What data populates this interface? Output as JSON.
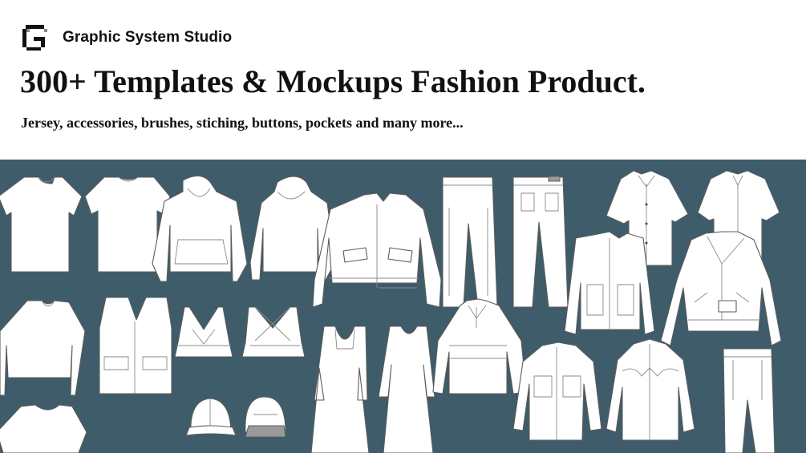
{
  "brand": {
    "name": "Graphic System Studio",
    "logo_icon": "graphic-system-studio-g-logo"
  },
  "headline": "300+ Templates & Mockups Fashion Product.",
  "subheadline": "Jersey, accessories, brushes, stiching, buttons, pockets and many more...",
  "colors": {
    "background": "#ffffff",
    "showcase_background": "#3e5c6a",
    "text": "#111111",
    "garment_fill": "#ffffff",
    "garment_outline": "#5c5c5c"
  },
  "garments": [
    "t-shirt",
    "t-shirt",
    "hoodie",
    "hoodie",
    "bomber-jacket",
    "trousers",
    "jeans",
    "short-sleeve-shirt",
    "short-sleeve-shirt",
    "crop-tee",
    "vest",
    "sports-bra",
    "sports-bra",
    "long-dress",
    "long-dress",
    "half-zip-pullover",
    "trucker-jacket",
    "biker-jacket",
    "cap",
    "cap",
    "utility-shirt",
    "western-shirt",
    "pleated-trousers",
    "t-shirt"
  ]
}
